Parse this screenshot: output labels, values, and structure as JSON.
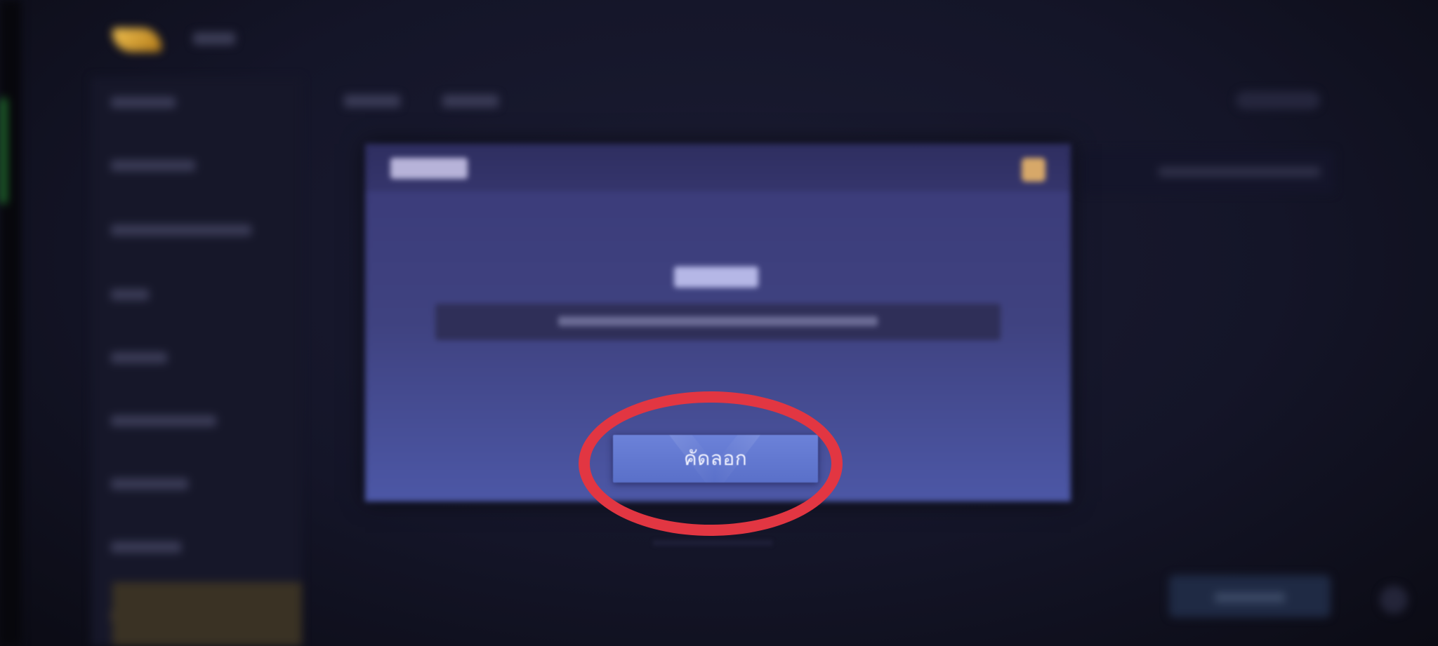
{
  "dialog": {
    "copy_button_label": "คัดลอก"
  },
  "colors": {
    "annotation": "#e23642",
    "button": "#6478d0",
    "dialog_bg": "#3f4280",
    "close_icon": "#d7a869",
    "logo": "#f0c050"
  },
  "icons": {
    "close": "close-icon",
    "logo": "app-logo"
  }
}
